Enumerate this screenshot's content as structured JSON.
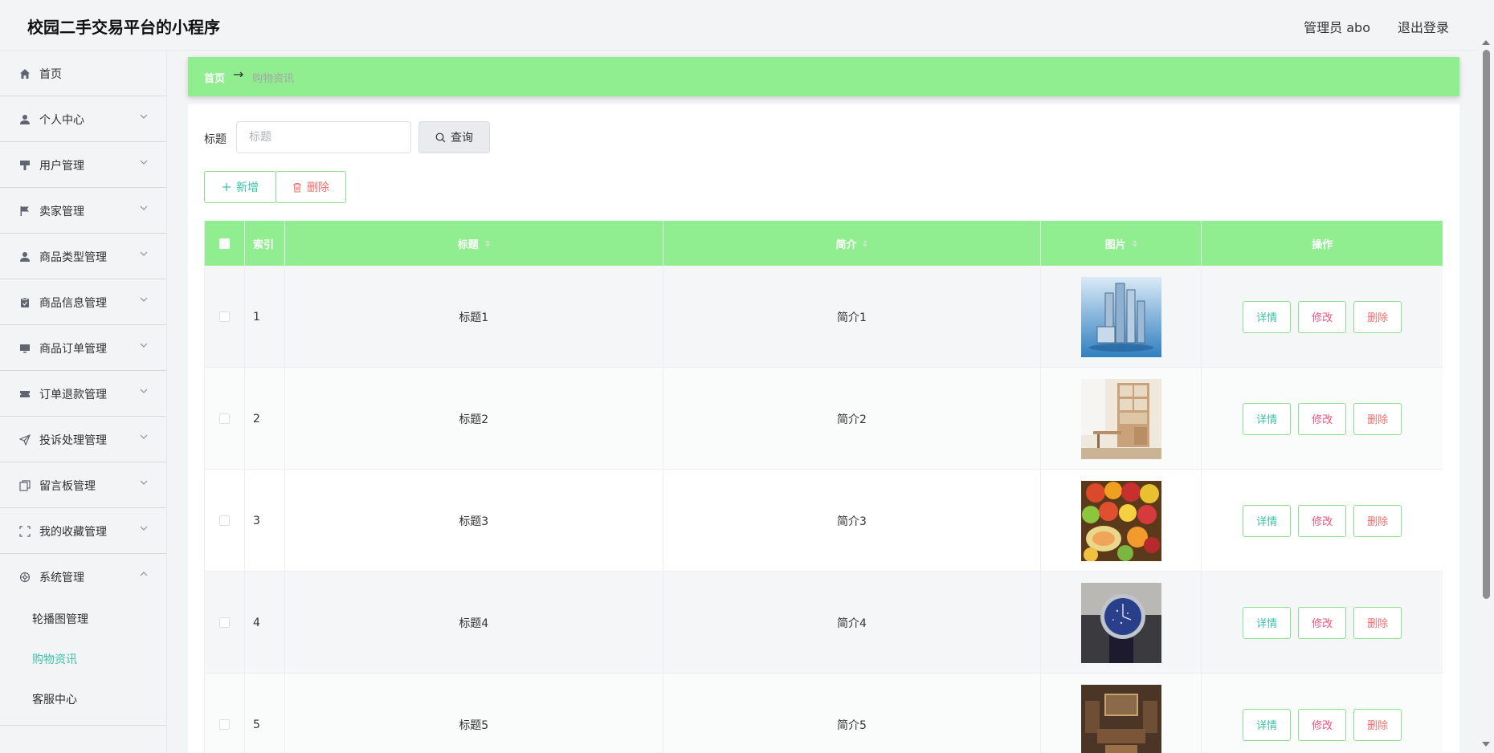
{
  "app": {
    "title": "校园二手交易平台的小程序",
    "user": "管理员 abo",
    "logout": "退出登录"
  },
  "sidebar": {
    "items": [
      {
        "label": "首页",
        "icon": "home-icon"
      },
      {
        "label": "个人中心",
        "icon": "user-icon"
      },
      {
        "label": "用户管理",
        "icon": "brush-icon"
      },
      {
        "label": "卖家管理",
        "icon": "flag-icon"
      },
      {
        "label": "商品类型管理",
        "icon": "user-icon"
      },
      {
        "label": "商品信息管理",
        "icon": "clipboard-icon"
      },
      {
        "label": "商品订单管理",
        "icon": "monitor-icon"
      },
      {
        "label": "订单退款管理",
        "icon": "ticket-icon"
      },
      {
        "label": "投诉处理管理",
        "icon": "send-icon"
      },
      {
        "label": "留言板管理",
        "icon": "copy-icon"
      },
      {
        "label": "我的收藏管理",
        "icon": "full-screen-icon"
      },
      {
        "label": "系统管理",
        "icon": "settings-icon"
      }
    ],
    "sub_items": [
      {
        "label": "轮播图管理"
      },
      {
        "label": "购物资讯"
      },
      {
        "label": "客服中心"
      }
    ]
  },
  "breadcrumb": {
    "home": "首页",
    "separator": "→",
    "current": "购物资讯"
  },
  "search": {
    "label": "标题",
    "placeholder": "标题",
    "button": "查询"
  },
  "actions": {
    "add": "新增",
    "delete": "删除"
  },
  "table": {
    "headers": {
      "index": "索引",
      "title": "标题",
      "desc": "简介",
      "image": "图片",
      "ops": "操作"
    },
    "rows": [
      {
        "index": "1",
        "title": "标题1",
        "desc": "简介1"
      },
      {
        "index": "2",
        "title": "标题2",
        "desc": "简介2"
      },
      {
        "index": "3",
        "title": "标题3",
        "desc": "简介3"
      },
      {
        "index": "4",
        "title": "标题4",
        "desc": "简介4"
      },
      {
        "index": "5",
        "title": "标题5",
        "desc": "简介5"
      }
    ],
    "op_labels": {
      "detail": "详情",
      "edit": "修改",
      "delete": "删除"
    }
  },
  "colors": {
    "accent_green": "#90ee90",
    "teal": "#3cc2a8",
    "danger": "#f56c6c",
    "pink": "#f5517a"
  }
}
